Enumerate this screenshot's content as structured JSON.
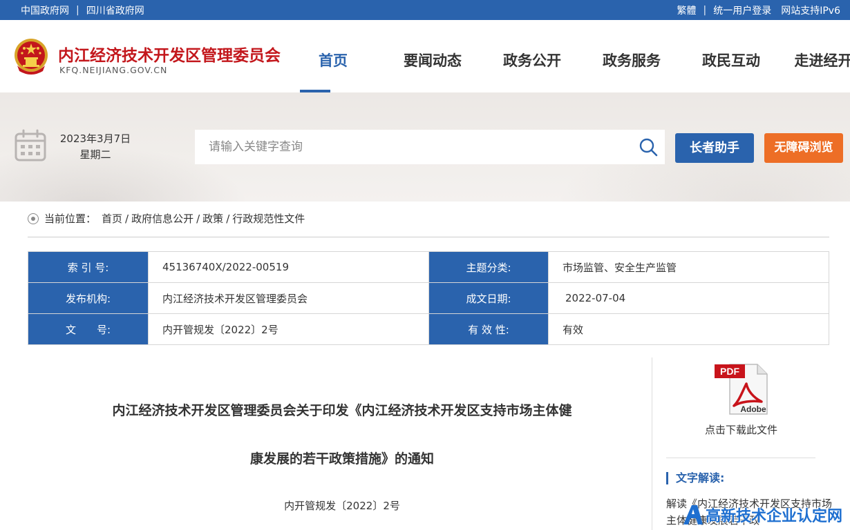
{
  "topbar": {
    "links_left": [
      "中国政府网",
      "四川省政府网"
    ],
    "links_right": [
      "繁體",
      "统一用户登录",
      "网站支持IPv6"
    ],
    "separator": "|"
  },
  "header": {
    "site_name": "内江经济技术开发区管理委员会",
    "site_domain": "KFQ.NEIJIANG.GOV.CN",
    "nav": [
      {
        "label": "首页",
        "active": true
      },
      {
        "label": "要闻动态",
        "active": false
      },
      {
        "label": "政务公开",
        "active": false
      },
      {
        "label": "政务服务",
        "active": false
      },
      {
        "label": "政民互动",
        "active": false
      },
      {
        "label": "走进经开区",
        "active": false
      }
    ]
  },
  "banner": {
    "date": "2023年3月7日",
    "weekday": "星期二",
    "search_placeholder": "请输入关键字查询",
    "elder_button": "长者助手",
    "accessibility_button": "无障碍浏览"
  },
  "breadcrumb": {
    "prefix": "当前位置：",
    "items": [
      "首页",
      "政府信息公开",
      "政策",
      "行政规范性文件"
    ],
    "separator": "/"
  },
  "meta": {
    "index_label": "索 引 号:",
    "index_value": "45136740X/2022-00519",
    "topic_label": "主题分类:",
    "topic_value": "市场监管、安全生产监管",
    "issuer_label": "发布机构:",
    "issuer_value": "内江经济技术开发区管理委员会",
    "date_label": "成文日期:",
    "date_value": "2022-07-04",
    "docno_label": "文　　号:",
    "docno_value": "内开管规发〔2022〕2号",
    "validity_label": "有 效 性:",
    "validity_value": "有效"
  },
  "document": {
    "title_line1": "内江经济技术开发区管理委员会关于印发《内江经济技术开发区支持市场主体健",
    "title_line2": "康发展的若干政策措施》的通知",
    "doc_number": "内开管规发〔2022〕2号"
  },
  "sidebar": {
    "pdf_badge": "PDF",
    "pdf_brand": "Adobe",
    "download_label": "点击下载此文件",
    "interp_title": "文字解读:",
    "interp_text": "解读《内江经济技术开发区支持市场主体健康发展若干政"
  },
  "watermark": {
    "text": "高新技术企业认定网"
  },
  "colors": {
    "primary": "#2a63ad",
    "brand_red": "#c3171c",
    "accent_orange": "#ed6e26"
  }
}
